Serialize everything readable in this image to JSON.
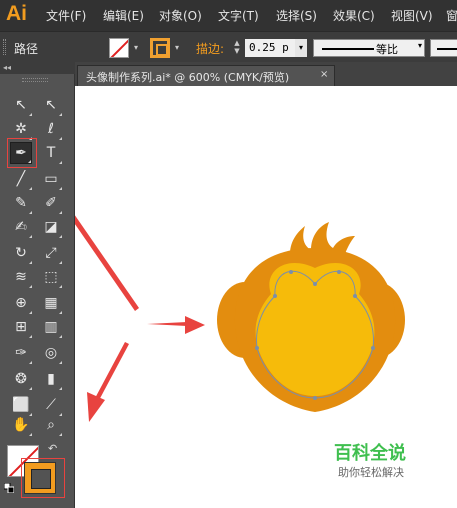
{
  "app": {
    "logo": "Ai"
  },
  "menu": [
    "文件(F)",
    "编辑(E)",
    "对象(O)",
    "文字(T)",
    "选择(S)",
    "效果(C)",
    "视图(V)",
    "窗"
  ],
  "controlbar": {
    "selection_label": "路径",
    "stroke_label": "描边:",
    "stroke_weight": "0.25 p",
    "profile_label": "等比"
  },
  "document": {
    "tab_title": "头像制作系列.ai* @ 600% (CMYK/预览)",
    "close_glyph": "×"
  },
  "toolpanel": {
    "collapse_glyph": "◂◂"
  },
  "tools": [
    {
      "name": "selection-tool",
      "glyph": "↖"
    },
    {
      "name": "direct-selection-tool",
      "glyph": "↖"
    },
    {
      "name": "magic-wand-tool",
      "glyph": "✲"
    },
    {
      "name": "lasso-tool",
      "glyph": "ℓ"
    },
    {
      "name": "pen-tool",
      "glyph": "✒"
    },
    {
      "name": "type-tool",
      "glyph": "T"
    },
    {
      "name": "line-segment-tool",
      "glyph": "╱"
    },
    {
      "name": "rectangle-tool",
      "glyph": "▭"
    },
    {
      "name": "paintbrush-tool",
      "glyph": "✎"
    },
    {
      "name": "pencil-tool",
      "glyph": "✐"
    },
    {
      "name": "blob-brush-tool",
      "glyph": "✍"
    },
    {
      "name": "eraser-tool",
      "glyph": "◪"
    },
    {
      "name": "rotate-tool",
      "glyph": "↻"
    },
    {
      "name": "scale-tool",
      "glyph": "⤢"
    },
    {
      "name": "width-tool",
      "glyph": "≋"
    },
    {
      "name": "free-transform-tool",
      "glyph": "⬚"
    },
    {
      "name": "shape-builder-tool",
      "glyph": "⊕"
    },
    {
      "name": "perspective-grid-tool",
      "glyph": "▦"
    },
    {
      "name": "mesh-tool",
      "glyph": "⊞"
    },
    {
      "name": "gradient-tool",
      "glyph": "▥"
    },
    {
      "name": "eyedropper-tool",
      "glyph": "✑"
    },
    {
      "name": "blend-tool",
      "glyph": "◎"
    },
    {
      "name": "symbol-sprayer-tool",
      "glyph": "❂"
    },
    {
      "name": "column-graph-tool",
      "glyph": "▮"
    },
    {
      "name": "artboard-tool",
      "glyph": "⬜"
    },
    {
      "name": "slice-tool",
      "glyph": "⟋"
    },
    {
      "name": "hand-tool",
      "glyph": "✋"
    },
    {
      "name": "zoom-tool",
      "glyph": "⌕"
    }
  ],
  "fill_stroke": {
    "swap_glyph": "↶"
  },
  "artwork": {
    "head_outer": "#E38D0F",
    "face": "#F6BB0A",
    "path_stroke": "#7C8FA8",
    "arrow_color": "#E8433F"
  },
  "watermark": {
    "brand": "百科全说",
    "subtitle": "助你轻松解决"
  }
}
